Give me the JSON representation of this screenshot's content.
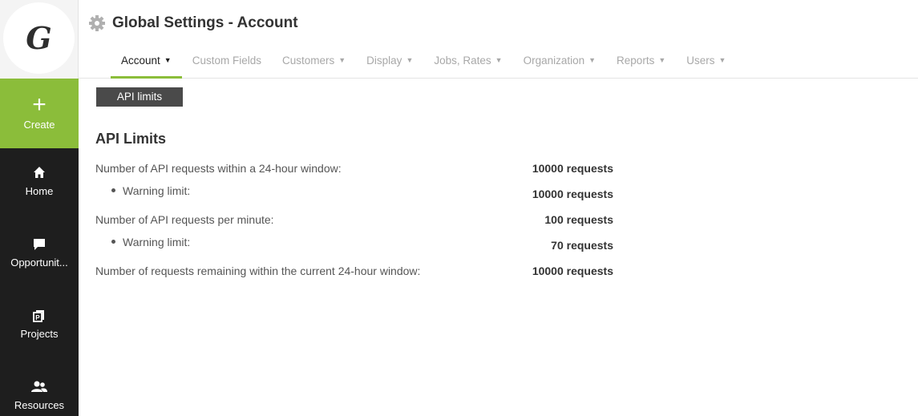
{
  "sidebar": {
    "logo_letter": "G",
    "create": {
      "icon": "plus-icon",
      "label": "Create"
    },
    "items": [
      {
        "icon": "home-icon",
        "label": "Home"
      },
      {
        "icon": "chat-bubble-icon",
        "label": "Opportunit..."
      },
      {
        "icon": "project-folder-icon",
        "label": "Projects"
      },
      {
        "icon": "people-icon",
        "label": "Resources"
      }
    ],
    "colors": {
      "background": "#1e1e1e",
      "accent": "#8bbd3a"
    }
  },
  "header": {
    "title_icon": "gear-icon",
    "title": "Global Settings - Account",
    "tabs": [
      {
        "label": "Account",
        "has_dropdown": true,
        "active": true
      },
      {
        "label": "Custom Fields",
        "has_dropdown": false,
        "active": false
      },
      {
        "label": "Customers",
        "has_dropdown": true,
        "active": false
      },
      {
        "label": "Display",
        "has_dropdown": true,
        "active": false
      },
      {
        "label": "Jobs, Rates",
        "has_dropdown": true,
        "active": false
      },
      {
        "label": "Organization",
        "has_dropdown": true,
        "active": false
      },
      {
        "label": "Reports",
        "has_dropdown": true,
        "active": false
      },
      {
        "label": "Users",
        "has_dropdown": true,
        "active": false
      }
    ],
    "caret": "▼"
  },
  "main": {
    "subtab_label": "API limits",
    "section_title": "API Limits",
    "rows": [
      {
        "label": "Number of API requests within a 24-hour window:",
        "value": "10000 requests"
      },
      {
        "label": "Warning limit:",
        "value": "10000 requests"
      },
      {
        "label": "Number of API requests per minute:",
        "value": "100 requests"
      },
      {
        "label": "Warning limit:",
        "value": "70 requests"
      },
      {
        "label": "Number of requests remaining within the current 24-hour window:",
        "value": "10000 requests"
      }
    ]
  }
}
